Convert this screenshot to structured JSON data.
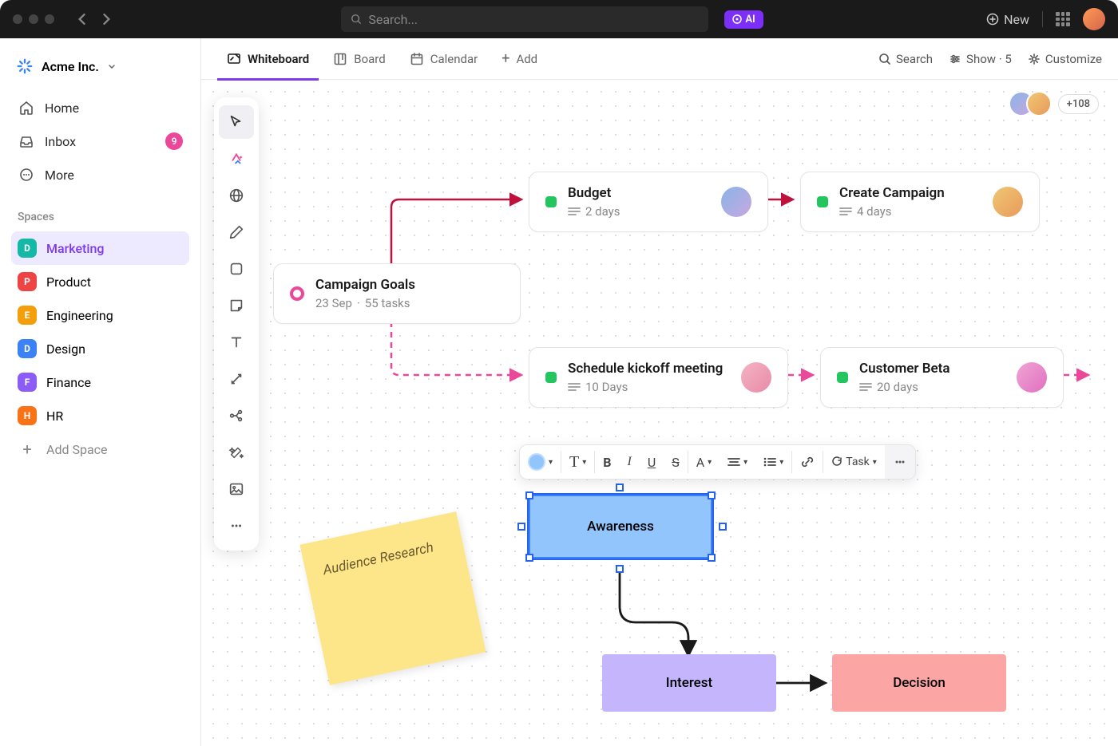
{
  "topbar": {
    "search_placeholder": "Search...",
    "ai_label": "AI",
    "new_label": "New"
  },
  "workspace": {
    "name": "Acme Inc."
  },
  "nav": {
    "home": "Home",
    "inbox": "Inbox",
    "inbox_badge": "9",
    "more": "More"
  },
  "spaces_label": "Spaces",
  "spaces": [
    {
      "letter": "D",
      "name": "Marketing",
      "color": "#14b8a6",
      "active": true
    },
    {
      "letter": "P",
      "name": "Product",
      "color": "#ef4444"
    },
    {
      "letter": "E",
      "name": "Engineering",
      "color": "#f59e0b"
    },
    {
      "letter": "D",
      "name": "Design",
      "color": "#3b82f6"
    },
    {
      "letter": "F",
      "name": "Finance",
      "color": "#8b5cf6"
    },
    {
      "letter": "H",
      "name": "HR",
      "color": "#f97316"
    }
  ],
  "add_space_label": "Add Space",
  "tabs": {
    "whiteboard": "Whiteboard",
    "board": "Board",
    "calendar": "Calendar",
    "add": "Add"
  },
  "tab_right": {
    "search": "Search",
    "show": "Show · 5",
    "customize": "Customize"
  },
  "collab_count": "+108",
  "cards": {
    "goals": {
      "title": "Campaign Goals",
      "date": "23 Sep",
      "tasks": "55 tasks"
    },
    "budget": {
      "title": "Budget",
      "sub": "2 days"
    },
    "campaign": {
      "title": "Create Campaign",
      "sub": "4 days"
    },
    "kickoff": {
      "title": "Schedule kickoff meeting",
      "sub": "10 Days"
    },
    "beta": {
      "title": "Customer Beta",
      "sub": "20 days"
    }
  },
  "sticky": "Audience Research",
  "shapes": {
    "awareness": "Awareness",
    "interest": "Interest",
    "decision": "Decision"
  },
  "fmt": {
    "task": "Task"
  },
  "colors": {
    "green": "#22c55e",
    "av1": "linear-gradient(135deg,#89b4e8,#c7a8e0)",
    "av2": "linear-gradient(135deg,#f0c674,#e89b5a)",
    "av3": "linear-gradient(135deg,#f4b4c4,#e88aa8)",
    "av4": "linear-gradient(135deg,#f0a4d4,#e070c0)"
  }
}
